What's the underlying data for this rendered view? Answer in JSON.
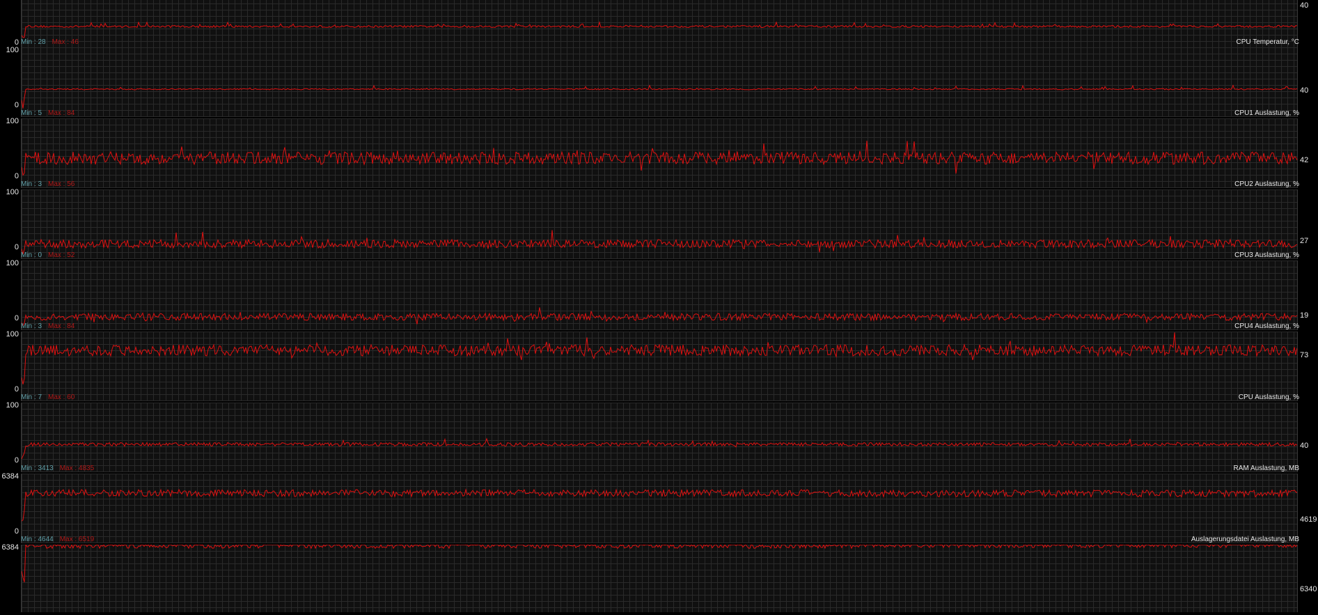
{
  "monitor": {
    "colors": {
      "background": "#000000",
      "grid": "#2a2a2a",
      "plot_bg": "#101010",
      "line": "#e01010",
      "min_text": "#5f9fa8",
      "max_text": "#b01818",
      "label_text": "#e8e8e8"
    },
    "panels": [
      {
        "title": "",
        "y_max": "",
        "y_min": "0",
        "current": "40",
        "min_label": "",
        "max_label": "",
        "level": 40,
        "scale": 100,
        "noise": 1.5,
        "spikes": 0.05,
        "step": 0
      },
      {
        "title": "CPU Temperatur, °C",
        "y_max": "100",
        "y_min": "0",
        "current": "40",
        "min_label": "Min : 28",
        "max_label": "Max : 46",
        "level": 40,
        "scale": 100,
        "noise": 0.9,
        "spikes": 0.03,
        "step": 0
      },
      {
        "title": "CPU1 Auslastung, %",
        "y_max": "100",
        "y_min": "0",
        "current": "42",
        "min_label": "Min : 5",
        "max_label": "Max : 84",
        "level": 43,
        "scale": 100,
        "noise": 9,
        "spikes": 0.04,
        "step": 0
      },
      {
        "title": "CPU2 Auslastung, %",
        "y_max": "100",
        "y_min": "0",
        "current": "27",
        "min_label": "Min : 3",
        "max_label": "Max : 56",
        "level": 22,
        "scale": 100,
        "noise": 6,
        "spikes": 0.03,
        "step": 0
      },
      {
        "title": "CPU3 Auslastung, %",
        "y_max": "100",
        "y_min": "0",
        "current": "19",
        "min_label": "Min : 0",
        "max_label": "Max : 52",
        "level": 19,
        "scale": 100,
        "noise": 5,
        "spikes": 0.03,
        "step": 0
      },
      {
        "title": "CPU4 Auslastung, %",
        "y_max": "100",
        "y_min": "0",
        "current": "73",
        "min_label": "Min : 3",
        "max_label": "Max : 84",
        "level": 73,
        "scale": 100,
        "noise": 8,
        "spikes": 0.04,
        "step": 0
      },
      {
        "title": "CPU Auslastung, %",
        "y_max": "100",
        "y_min": "0",
        "current": "40",
        "min_label": "Min : 7",
        "max_label": "Max : 60",
        "level": 40,
        "scale": 100,
        "noise": 2.5,
        "spikes": 0.03,
        "step": 0
      },
      {
        "title": "RAM Auslastung, MB",
        "y_max": "6384",
        "y_min": "0",
        "current": "4619",
        "min_label": "Min : 3413",
        "max_label": "Max : 4835",
        "level": 4600,
        "scale": 6384,
        "noise": 5,
        "spikes": 0,
        "step": 0
      },
      {
        "title": "Auslagerungsdatei Auslastung, MB",
        "y_max": "6384",
        "y_min": "0",
        "current": "6340",
        "min_label": "Min : 4644",
        "max_label": "Max : 6519",
        "level": 6340,
        "scale": 6384,
        "noise": 4,
        "spikes": 0,
        "step": 1
      }
    ]
  }
}
